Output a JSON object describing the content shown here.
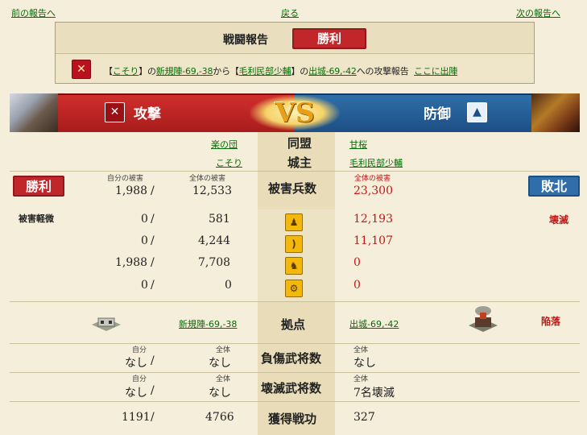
{
  "nav": {
    "prev": "前の報告へ",
    "back": "戻る",
    "next": "次の報告へ"
  },
  "header": {
    "title": "戦闘報告",
    "result": "勝利",
    "report": {
      "br_open": "【",
      "attacker_name": "こそり",
      "br_close_no": "】の",
      "from_base": "新規陣-69,-38",
      "kara": "から【",
      "defender_name": "毛利民部少輔",
      "br_close_no2": "】の",
      "to_base": "出城-69,-42",
      "suffix": "への攻撃報告",
      "sortie": "ここに出陣"
    }
  },
  "banner": {
    "attack": "攻撃",
    "defense": "防御",
    "vs": "VS"
  },
  "alliance": {
    "label": "同盟",
    "attacker": "楽の団",
    "defender": "甘桜"
  },
  "lord": {
    "label": "城主",
    "attacker": "こそり",
    "defender": "毛利民部少輔"
  },
  "losses": {
    "label": "被害兵数",
    "own_label": "自分の被害",
    "total_label": "全体の被害",
    "def_total_label": "全体の被害",
    "attacker_own": "1,988",
    "attacker_total": "12,533",
    "defender_total": "23,300",
    "attacker_result": "勝利",
    "defender_result": "敗北",
    "attacker_note": "被害軽微",
    "defender_note": "壊滅"
  },
  "unit_rows": [
    {
      "icon": "spear-icon",
      "own": "0",
      "total": "581",
      "defender": "12,193"
    },
    {
      "icon": "bow-icon",
      "own": "0",
      "total": "4,244",
      "defender": "11,107"
    },
    {
      "icon": "horse-icon",
      "own": "1,988",
      "total": "7,708",
      "defender": "0"
    },
    {
      "icon": "siege-icon",
      "own": "0",
      "total": "0",
      "defender": "0"
    }
  ],
  "base": {
    "label": "拠点",
    "attacker": "新規陣-69,-38",
    "defender": "出城-69,-42",
    "defender_status": "陥落"
  },
  "wounded": {
    "label": "負傷武将数",
    "own_label": "自分",
    "total_label": "全体",
    "def_label": "全体",
    "own": "なし",
    "total": "なし",
    "defender": "なし"
  },
  "destroyed": {
    "label": "壊滅武将数",
    "own_label": "自分",
    "total_label": "全体",
    "def_label": "全体",
    "own": "なし",
    "total": "なし",
    "defender": "7名壊滅"
  },
  "merit": {
    "label": "獲得戦功",
    "own": "1191",
    "total": "4766",
    "defender": "327"
  },
  "slash": "/",
  "colors": {
    "win_red": "#c0262a",
    "lose_blue": "#2f6ea8",
    "link_green": "#0a6b0a",
    "gold": "#e8a018"
  }
}
